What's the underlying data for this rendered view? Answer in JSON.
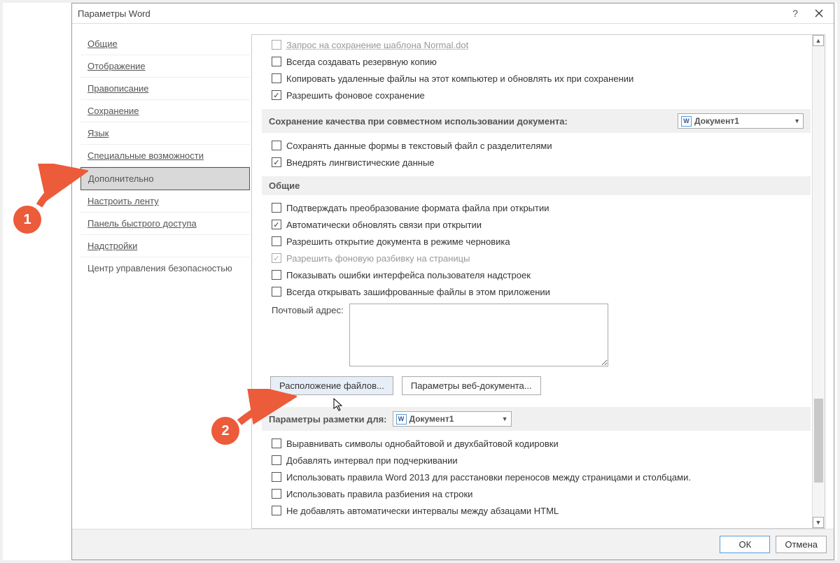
{
  "dialog": {
    "title": "Параметры Word"
  },
  "sidebar": {
    "items": [
      "Общие",
      "Отображение",
      "Правописание",
      "Сохранение",
      "Язык",
      "Специальные возможности",
      "Дополнительно",
      "Настроить ленту",
      "Панель быстрого доступа",
      "Надстройки",
      "Центр управления безопасностью"
    ],
    "active_index": 6
  },
  "top_partial": "Запрос на сохранение шаблона Normal.dot",
  "checks1": [
    {
      "label": "Всегда создавать резервную копию",
      "checked": false
    },
    {
      "label": "Копировать удаленные файлы на этот компьютер и обновлять их при сохранении",
      "checked": false
    },
    {
      "label": "Разрешить фоновое сохранение",
      "checked": true
    }
  ],
  "sectionA": {
    "label": "Сохранение качества при совместном использовании документа:",
    "dropdown": "Документ1"
  },
  "checks2": [
    {
      "label": "Сохранять данные формы в текстовый файл с разделителями",
      "checked": false
    },
    {
      "label": "Внедрять лингвистические данные",
      "checked": true
    }
  ],
  "sectionB": {
    "label": "Общие"
  },
  "checks3": [
    {
      "label": "Подтверждать преобразование формата файла при открытии",
      "checked": false
    },
    {
      "label": "Автоматически обновлять связи при открытии",
      "checked": true
    },
    {
      "label": "Разрешить открытие документа в режиме черновика",
      "checked": false
    },
    {
      "label": "Разрешить фоновую разбивку на страницы",
      "checked": true,
      "disabled": true
    },
    {
      "label": "Показывать ошибки интерфейса пользователя надстроек",
      "checked": false
    },
    {
      "label": "Всегда открывать зашифрованные файлы в этом приложении",
      "checked": false
    }
  ],
  "mail_label": "Почтовый адрес:",
  "buttons_mid": {
    "file_loc": "Расположение файлов...",
    "web_opts": "Параметры веб-документа..."
  },
  "sectionC": {
    "label": "Параметры разметки для:",
    "dropdown": "Документ1"
  },
  "checks4": [
    {
      "label": "Выравнивать символы однобайтовой и двухбайтовой кодировки",
      "checked": false
    },
    {
      "label": "Добавлять интервал при подчеркивании",
      "checked": false
    },
    {
      "label": "Использовать правила Word 2013 для расстановки переносов между страницами и столбцами.",
      "checked": false
    },
    {
      "label": "Использовать правила разбиения на строки",
      "checked": false
    },
    {
      "label": "Не добавлять автоматически интервалы между абзацами HTML",
      "checked": false
    }
  ],
  "footer": {
    "ok": "ОК",
    "cancel": "Отмена"
  },
  "callouts": {
    "one": "1",
    "two": "2"
  }
}
